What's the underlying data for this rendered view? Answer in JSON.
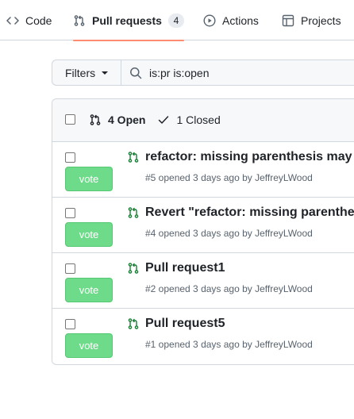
{
  "tabs": [
    {
      "label": "Code",
      "icon": "code-icon"
    },
    {
      "label": "Pull requests",
      "icon": "git-pull-request-icon",
      "count": "4",
      "selected": true
    },
    {
      "label": "Actions",
      "icon": "play-icon"
    },
    {
      "label": "Projects",
      "icon": "table-icon"
    }
  ],
  "filter_bar": {
    "filters_label": "Filters",
    "search_value": "is:pr is:open"
  },
  "list_header": {
    "open_label": "4 Open",
    "closed_label": "1 Closed"
  },
  "pull_requests": [
    {
      "title": "refactor: missing parenthesis may",
      "meta": "#5 opened 3 days ago by JeffreyLWood",
      "vote_label": "vote"
    },
    {
      "title": "Revert \"refactor: missing parenthe",
      "meta": "#4 opened 3 days ago by JeffreyLWood",
      "vote_label": "vote"
    },
    {
      "title": "Pull request1",
      "meta": "#2 opened 3 days ago by JeffreyLWood",
      "vote_label": "vote"
    },
    {
      "title": "Pull request5",
      "meta": "#1 opened 3 days ago by JeffreyLWood",
      "vote_label": "vote"
    }
  ],
  "colors": {
    "vote_button": "#6ddb89",
    "pr_open_icon": "#1a7f37",
    "selected_tab_underline": "#fd8c73"
  }
}
